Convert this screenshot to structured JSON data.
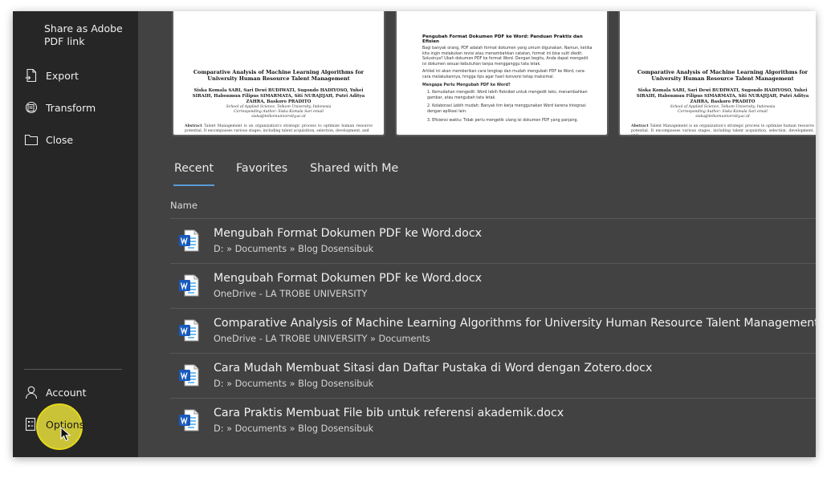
{
  "sidebar": {
    "share_label": "Share as Adobe PDF link",
    "items": [
      {
        "label": "Export",
        "icon": "export-icon"
      },
      {
        "label": "Transform",
        "icon": "transform-icon"
      },
      {
        "label": "Close",
        "icon": "folder-icon"
      }
    ],
    "bottom_items": [
      {
        "label": "Account",
        "icon": "person-icon"
      },
      {
        "label": "Options",
        "icon": "options-icon"
      }
    ]
  },
  "thumbnails": {
    "left": {
      "title": "Comparative Analysis of Machine Learning Algorithms for University Human Resource Talent Management",
      "authors": "Siska Komala SARI, Sari Dewi BUDIWATI, Sugondo HADIYOSO, Yuhei SIRAIH, Habonmun Filipus SIMARMATA, Siti NURAJIJAH, Putri Aditya ZAHRA, Baskoro PRADITO",
      "affil": "School of Applied Science, Telkom University, Indonesia",
      "corr": "Corresponding Author: Siska Komala Sari email",
      "email": "siska@telkomuniversity.ac.id",
      "abstract_lead": "Abstract",
      "abstract_text": "Talent Management is an organization's strategic process to optimize human resource potential. It encompasses various stages, including talent acquisition, selection, development, and"
    },
    "middle": {
      "title": "Pengubah Format Dokumen PDF ke Word: Panduan Praktis dan Efisien",
      "p1": "Bagi banyak orang, PDF adalah format dokumen yang umum digunakan. Namun, ketika kita ingin melakukan revisi atau menambahkan catatan, format ini bisa sulit diedit. Solusinya? Ubah dokumen PDF ke format Word. Dengan begitu, Anda dapat mengedit isi dokumen sesuai kebutuhan tanpa mengganggu tata letak.",
      "p2": "Artikel ini akan memberikan cara lengkap dan mudah mengubah PDF ke Word, cara-cara melakukannya, hingga tips agar hasil konversi tetap maksimal.",
      "subtitle": "Mengapa Perlu Mengubah PDF ke Word?",
      "list": [
        "1. Kemudahan mengedit: Word lebih fleksibel untuk mengedit teks, menambahkan gambar, atau mengubah tata letak.",
        "2. Kolaborasi Lebih mudah: Banyak tim kerja menggunakan Word karena integrasi dengan aplikasi lain.",
        "3. Efisiensi waktu: Tidak perlu mengetik ulang isi dokumen PDF yang panjang."
      ]
    },
    "right": {
      "title": "Comparative Analysis of Machine Learning Algorithms for University Human Resource Talent Management",
      "authors": "Siska Komala SARI, Sari Dewi BUDIWATI, Sugondo HADIYOSO, Yuhei SIRAIH, Habonmun Filipus SIMARMATA, Siti NURAJIJAH, Putri Aditya ZAHRA, Baskoro PRADITO",
      "affil": "School of Applied Science, Telkom University, Indonesia",
      "corr": "Corresponding Author: Siska Komala Sari email",
      "email": "siska@telkomuniversity.ac.id",
      "abstract_lead": "Abstract",
      "abstract_text": "Talent Management is an organization's strategic process to optimize human resource potential. It encompasses various stages, including talent acquisition, selection, development, and"
    }
  },
  "tabs": [
    {
      "label": "Recent",
      "active": true
    },
    {
      "label": "Favorites",
      "active": false
    },
    {
      "label": "Shared with Me",
      "active": false
    }
  ],
  "list_header": {
    "name": "Name"
  },
  "files": [
    {
      "name": "Mengubah Format Dokumen PDF ke Word.docx",
      "path": "D: » Documents » Blog Dosensibuk"
    },
    {
      "name": "Mengubah Format Dokumen PDF ke Word.docx",
      "path": "OneDrive - LA TROBE UNIVERSITY"
    },
    {
      "name": "Comparative Analysis of Machine Learning Algorithms for University Human Resource Talent Management-Correc",
      "path": "OneDrive - LA TROBE UNIVERSITY » Documents"
    },
    {
      "name": "Cara Mudah Membuat Sitasi dan Daftar Pustaka di Word dengan Zotero.docx",
      "path": "D: » Documents » Blog Dosensibuk"
    },
    {
      "name": "Cara Praktis Membuat File bib untuk referensi akademik.docx",
      "path": "D: » Documents » Blog Dosensibuk"
    }
  ],
  "colors": {
    "sidebar_bg": "#262626",
    "main_bg": "#424242",
    "accent": "#5b9bd5",
    "word_blue": "#185abd",
    "highlight": "#f0e63c"
  }
}
